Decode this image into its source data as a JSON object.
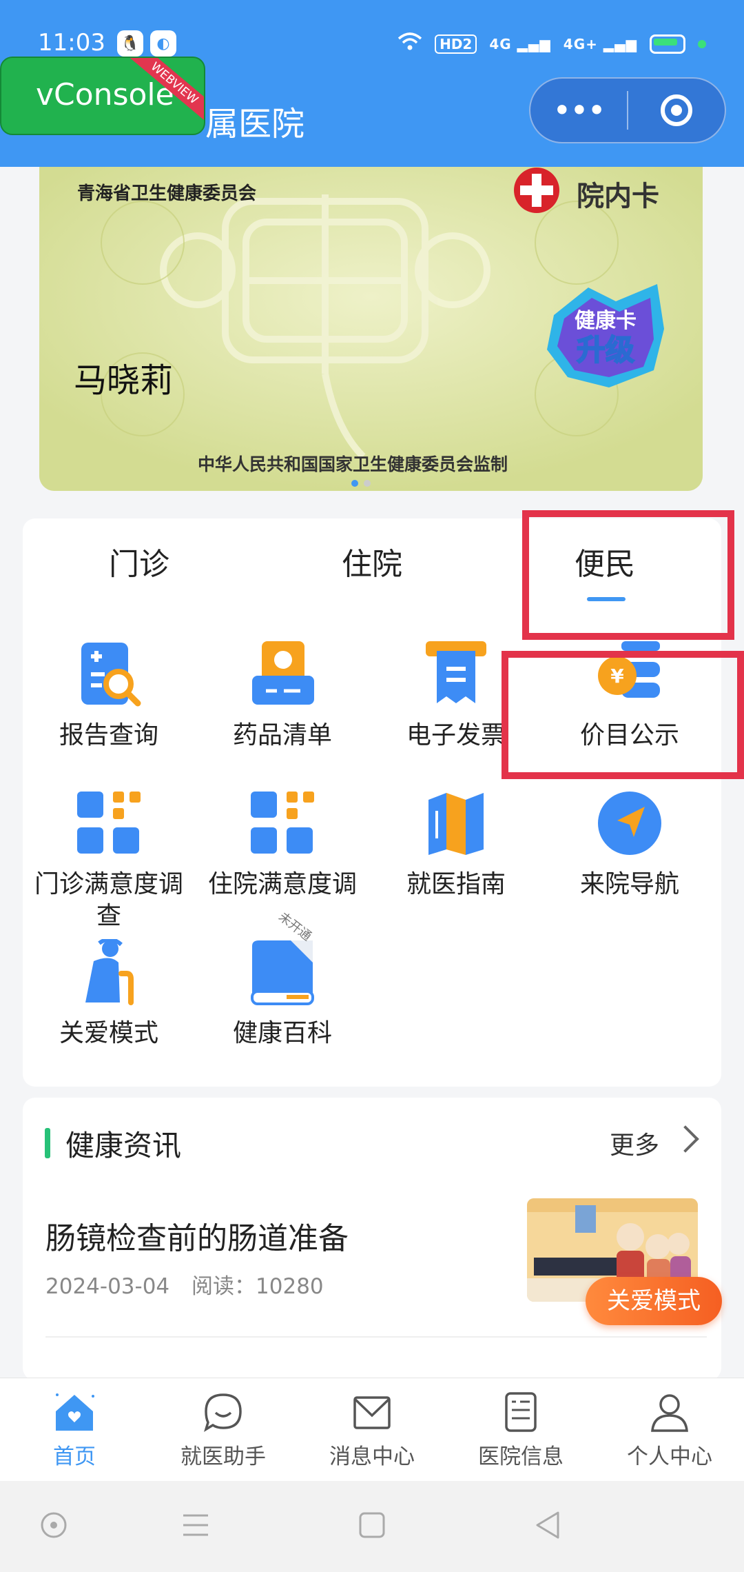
{
  "status_bar": {
    "time": "11:03",
    "app_icons": [
      "qq-icon",
      "browser-icon"
    ],
    "hd_badge": "HD2",
    "signal_1": "4G",
    "signal_2": "4G+",
    "battery": "charging"
  },
  "vconsole": {
    "label": "vConsole",
    "ribbon": "WEBVIEW"
  },
  "header": {
    "title": "属医院"
  },
  "capsule": {
    "more": "•••",
    "close_icon": "target-icon"
  },
  "health_card": {
    "issuer": "青海省卫生健康委员会",
    "card_type": "院内卡",
    "holder_name": "马晓莉",
    "supervisor": "中华人民共和国国家卫生健康委员会监制",
    "upgrade_badge": [
      "健康卡",
      "升级"
    ],
    "carousel_pages": 2,
    "carousel_active": 0
  },
  "tabs": [
    {
      "label": "门诊"
    },
    {
      "label": "住院"
    },
    {
      "label": "便民",
      "active": true
    }
  ],
  "services": [
    {
      "label": "报告查询",
      "icon": "report-search-icon"
    },
    {
      "label": "药品清单",
      "icon": "medicine-list-icon"
    },
    {
      "label": "电子发票",
      "icon": "e-invoice-icon"
    },
    {
      "label": "价目公示",
      "icon": "price-list-icon"
    },
    {
      "label": "门诊满意度调查",
      "icon": "outpatient-survey-icon"
    },
    {
      "label": "住院满意度调查",
      "icon": "inpatient-survey-icon"
    },
    {
      "label": "就医指南",
      "icon": "medical-guide-icon"
    },
    {
      "label": "来院导航",
      "icon": "navigation-icon"
    },
    {
      "label": "关爱模式",
      "icon": "elderly-care-icon"
    },
    {
      "label": "健康百科",
      "icon": "health-encyclopedia-icon",
      "badge": "未开通"
    }
  ],
  "news": {
    "section_title": "健康资讯",
    "more_label": "更多",
    "articles": [
      {
        "title": "肠镜检查前的肠道准备",
        "date": "2024-03-04",
        "reads_label": "阅读：10280"
      }
    ]
  },
  "care_mode_button": "关爱模式",
  "tabbar": [
    {
      "label": "首页",
      "icon": "home-icon",
      "active": true
    },
    {
      "label": "就医助手",
      "icon": "chat-assistant-icon"
    },
    {
      "label": "消息中心",
      "icon": "mail-icon"
    },
    {
      "label": "医院信息",
      "icon": "document-icon"
    },
    {
      "label": "个人中心",
      "icon": "person-icon"
    }
  ],
  "colors": {
    "primary": "#3f97f3",
    "highlight_box": "#e3334a",
    "vconsole_green": "#21b24e",
    "care_orange": "#f55f22"
  }
}
